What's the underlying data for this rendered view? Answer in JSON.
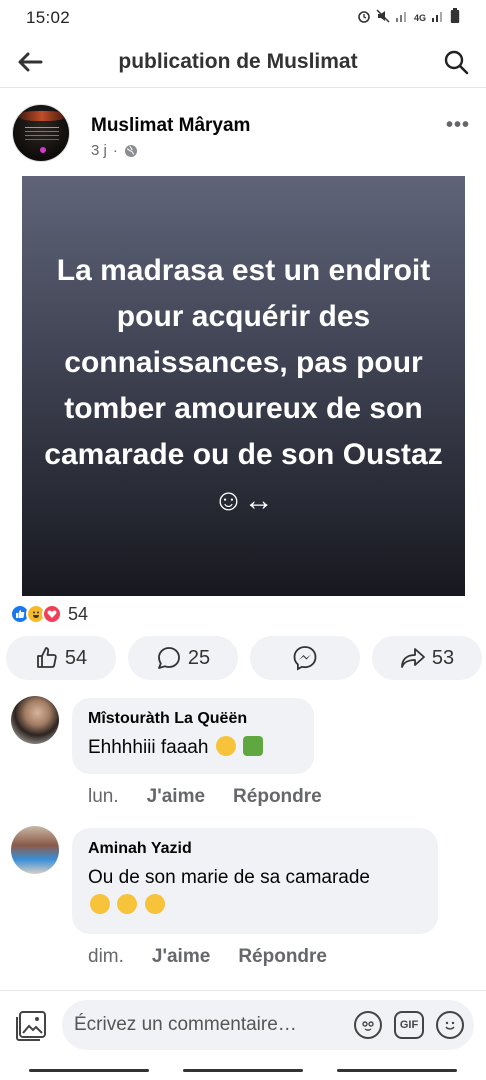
{
  "status": {
    "time": "15:02",
    "network": "4G"
  },
  "header": {
    "title": "publication de Muslimat"
  },
  "post": {
    "author": "Muslimat Mâryam",
    "age": "3 j",
    "separator": "·",
    "text": "La madrasa est un endroit pour acquérir des connaissances, pas pour tomber amoureux de son camarade ou de son Oustaz ☺↔",
    "reaction_count": "54"
  },
  "actions": {
    "likes": "54",
    "comments": "25",
    "shares": "53"
  },
  "comments": [
    {
      "name": "Mîstouràth La Quëën",
      "text": "Ehhhhiii faaah",
      "time": "lun.",
      "like": "J'aime",
      "reply": "Répondre"
    },
    {
      "name": "Aminah Yazid",
      "text": "Ou de son marie de sa camarade",
      "time": "dim.",
      "like": "J'aime",
      "reply": "Répondre"
    }
  ],
  "composer": {
    "placeholder": "Écrivez un commentaire…",
    "gif": "GIF"
  },
  "colors": {
    "brand": "#1877f2",
    "bubble": "#f0f2f5"
  }
}
